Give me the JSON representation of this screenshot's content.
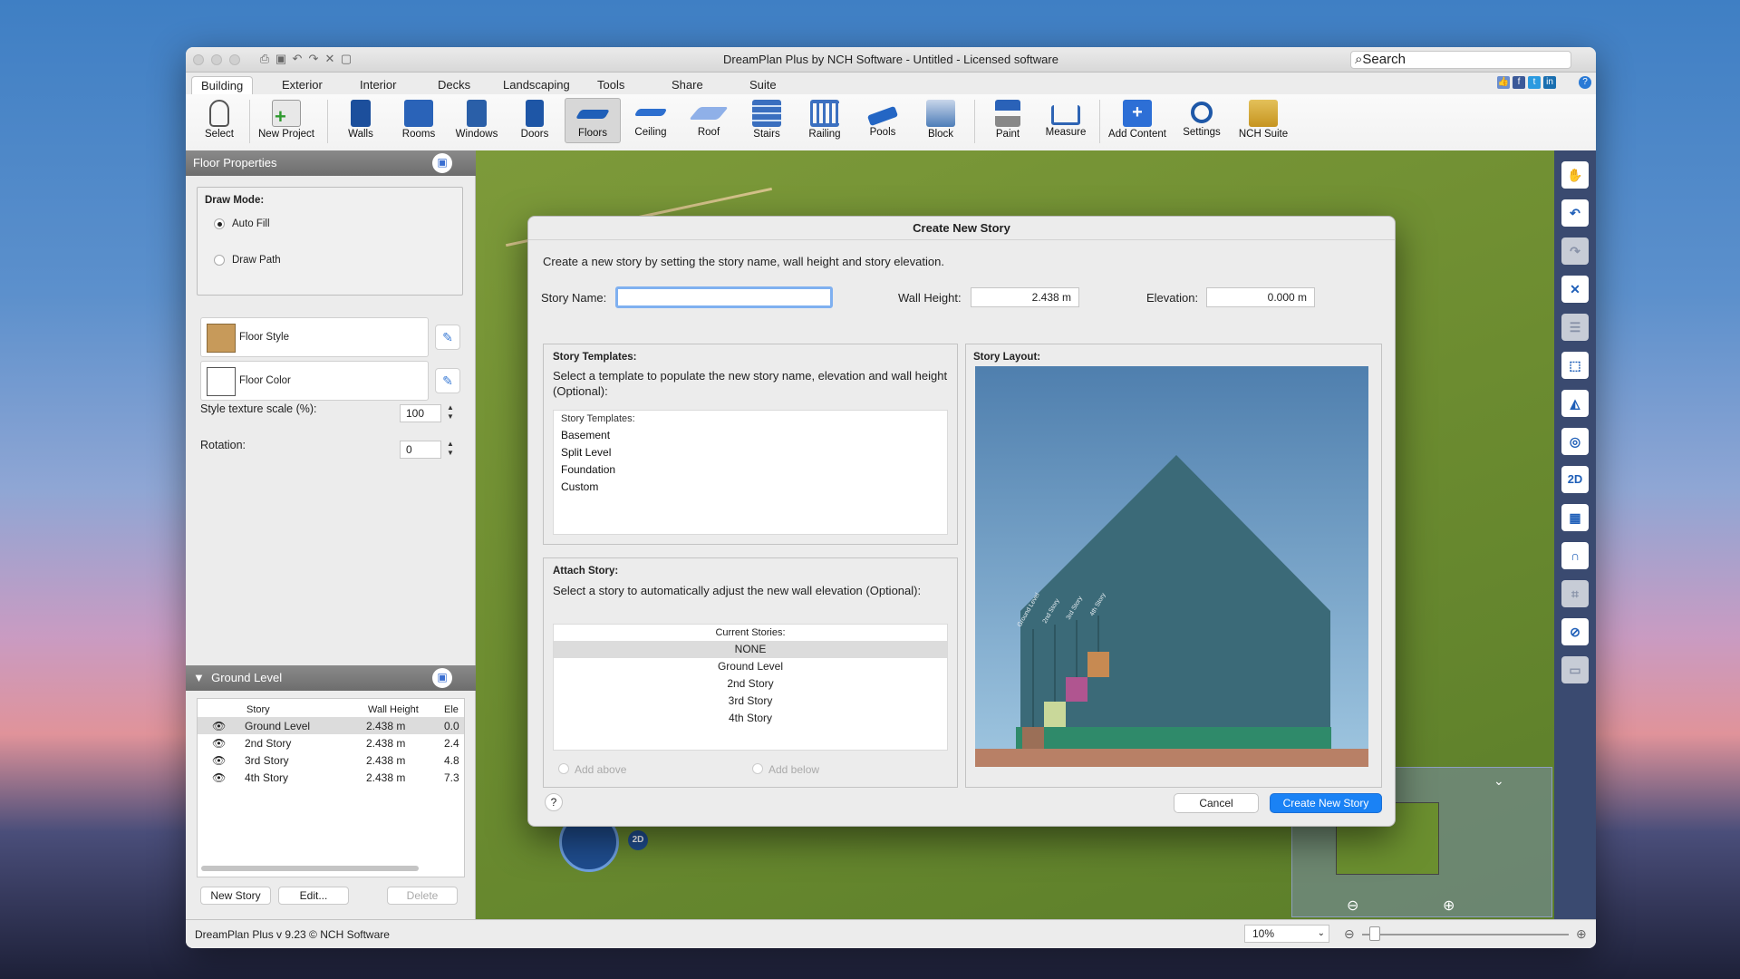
{
  "window": {
    "title": "DreamPlan Plus by NCH Software - Untitled - Licensed software",
    "search_label": "Search"
  },
  "tabs": [
    "Building",
    "Exterior",
    "Interior",
    "Decks",
    "Landscaping",
    "Tools",
    "Share",
    "Suite"
  ],
  "ribbon": [
    {
      "label": "Select",
      "icon": "hand-icon",
      "color": "#555555"
    },
    {
      "label": "New Project",
      "icon": "new-project-icon",
      "color": "#3c8c3c"
    },
    {
      "label": "Walls",
      "icon": "walls-icon",
      "color": "#1c4f9c"
    },
    {
      "label": "Rooms",
      "icon": "rooms-icon",
      "color": "#2a63b8"
    },
    {
      "label": "Windows",
      "icon": "windows-icon",
      "color": "#2a5fa8"
    },
    {
      "label": "Doors",
      "icon": "doors-icon",
      "color": "#1e56a6"
    },
    {
      "label": "Floors",
      "icon": "floors-icon",
      "color": "#1f5fb8"
    },
    {
      "label": "Ceiling",
      "icon": "ceiling-icon",
      "color": "#2d6fcf"
    },
    {
      "label": "Roof",
      "icon": "roof-icon",
      "color": "#5a8ee0"
    },
    {
      "label": "Stairs",
      "icon": "stairs-icon",
      "color": "#3a6fbf"
    },
    {
      "label": "Railing",
      "icon": "railing-icon",
      "color": "#3c70c0"
    },
    {
      "label": "Pools",
      "icon": "pools-icon",
      "color": "#2466c4"
    },
    {
      "label": "Block",
      "icon": "block-icon",
      "color": "#4d7db8"
    },
    {
      "label": "Paint",
      "icon": "paint-icon",
      "color": "#2a62b8"
    },
    {
      "label": "Measure",
      "icon": "measure-icon",
      "color": "#2e64b4"
    },
    {
      "label": "Add Content",
      "icon": "add-content-icon",
      "color": "#2d6fd6"
    },
    {
      "label": "Settings",
      "icon": "settings-icon",
      "color": "#1e58a8"
    },
    {
      "label": "NCH Suite",
      "icon": "nch-suite-icon",
      "color": "#d9a62a"
    }
  ],
  "floor_properties": {
    "title": "Floor Properties",
    "draw_mode_label": "Draw Mode:",
    "auto_fill": "Auto Fill",
    "draw_path": "Draw Path",
    "floor_style": "Floor Style",
    "floor_color": "Floor Color",
    "texture_scale_label": "Style texture scale (%):",
    "texture_scale_value": "100",
    "rotation_label": "Rotation:",
    "rotation_value": "0"
  },
  "stories_panel": {
    "title": "Ground Level",
    "columns": [
      "Story",
      "Wall Height",
      "Ele"
    ],
    "rows": [
      {
        "name": "Ground Level",
        "height": "2.438 m",
        "elev": "0.0"
      },
      {
        "name": "2nd Story",
        "height": "2.438 m",
        "elev": "2.4"
      },
      {
        "name": "3rd Story",
        "height": "2.438 m",
        "elev": "4.8"
      },
      {
        "name": "4th Story",
        "height": "2.438 m",
        "elev": "7.3"
      }
    ],
    "new_story": "New Story",
    "edit": "Edit...",
    "delete": "Delete"
  },
  "status": {
    "version": "DreamPlan Plus v 9.23 © NCH Software",
    "zoom": "10%"
  },
  "dialog": {
    "title": "Create New Story",
    "intro": "Create a new story by setting the story name, wall height and story elevation.",
    "story_name_label": "Story Name:",
    "story_name_value": "",
    "wall_height_label": "Wall Height:",
    "wall_height_value": "2.438 m",
    "elevation_label": "Elevation:",
    "elevation_value": "0.000 m",
    "templates_title": "Story Templates:",
    "templates_desc": "Select a template to populate the new story name, elevation and wall height (Optional):",
    "templates_header": "Story Templates:",
    "templates": [
      "Basement",
      "Split Level",
      "Foundation",
      "Custom"
    ],
    "attach_title": "Attach Story:",
    "attach_desc": "Select a story to automatically adjust the new wall elevation (Optional):",
    "current_header": "Current Stories:",
    "current_stories": [
      "NONE",
      "Ground Level",
      "2nd Story",
      "3rd Story",
      "4th Story"
    ],
    "add_above": "Add above",
    "add_below": "Add below",
    "layout_title": "Story Layout:",
    "layout_labels": [
      "Ground Level",
      "2nd Story",
      "3rd Story",
      "4th Story"
    ],
    "help": "?",
    "cancel": "Cancel",
    "create": "Create New Story"
  },
  "right_toolbar": [
    "hand-icon",
    "undo-icon",
    "redo-icon",
    "close-icon",
    "notes-icon",
    "3d-box-icon",
    "terrain-icon",
    "view-icon",
    "2d-icon",
    "grid-icon",
    "magnet-icon",
    "crop-icon",
    "compass-icon",
    "tag-icon"
  ],
  "accent_color": "#1a82f5"
}
